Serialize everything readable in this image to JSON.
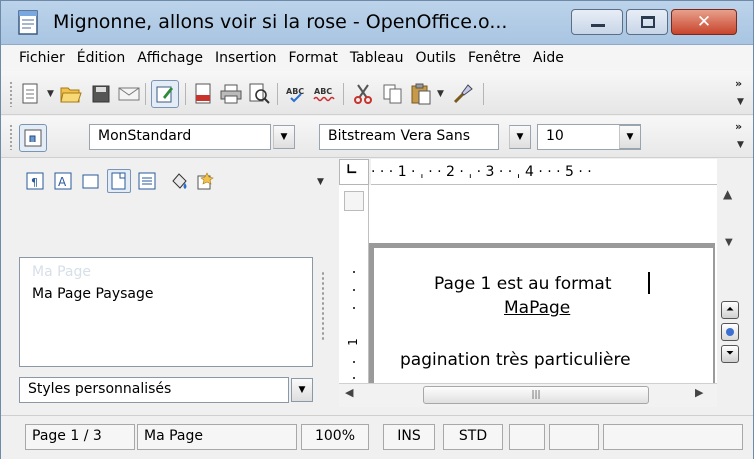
{
  "window": {
    "title": "Mignonne, allons voir si la rose - OpenOffice.o...",
    "close_label": "✕"
  },
  "menu": [
    "Fichier",
    "Édition",
    "Affichage",
    "Insertion",
    "Format",
    "Tableau",
    "Outils",
    "Fenêtre",
    "Aide"
  ],
  "toolbar": {
    "icons": [
      "new-document-icon",
      "open-folder-icon",
      "save-icon",
      "email-icon",
      "edit-mode-icon",
      "export-pdf-icon",
      "print-icon",
      "page-preview-icon",
      "spellcheck-icon",
      "autospellcheck-icon",
      "cut-icon",
      "copy-icon",
      "paste-icon",
      "clone-formatting-icon"
    ]
  },
  "format_toolbar": {
    "paragraph_style": "MonStandard",
    "font_name": "Bitstream Vera Sans",
    "font_size": "10"
  },
  "styles_panel": {
    "styles": [
      "Ma Page",
      "Ma Page Paysage"
    ],
    "selected_style": "Ma Page",
    "filter": "Styles personnalisés"
  },
  "ruler": {
    "horizontal": "· · · 1 · ˌ · · 2 · ˌ · 3 · · ˌ 4 · · · 5 · ·",
    "vertical_number": "1"
  },
  "document": {
    "line1": "Page 1 est au format",
    "line2": "MaPage",
    "line3": "pagination très particulière"
  },
  "statusbar": {
    "page": "Page 1 / 3",
    "page_style": "Ma Page",
    "zoom": "100%",
    "insert_mode": "INS",
    "selection_mode": "STD"
  },
  "colors": {
    "titlebar": "#bcd3ea",
    "close_button": "#c8442c",
    "selection_text": "#d7dfe8"
  }
}
